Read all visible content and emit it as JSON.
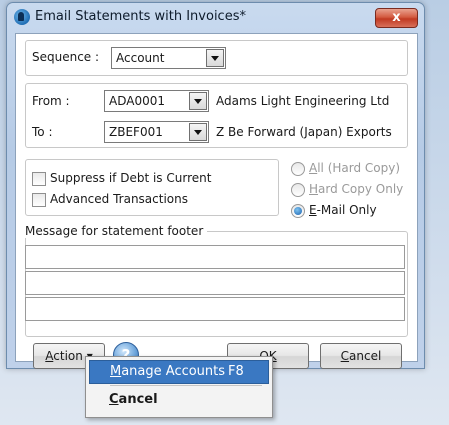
{
  "window": {
    "title": "Email Statements with Invoices*",
    "close_label": "x"
  },
  "sequence": {
    "label": "Sequence :",
    "value": "Account"
  },
  "range": {
    "from_label": "From :",
    "from_code": "ADA0001",
    "from_name": "Adams Light Engineering Ltd",
    "to_label": "To :",
    "to_code": "ZBEF001",
    "to_name": "Z Be Forward (Japan) Exports"
  },
  "options": {
    "suppress_label": "Suppress if Debt is Current",
    "suppress_checked": false,
    "advanced_label": "Advanced Transactions",
    "advanced_checked": false
  },
  "output": {
    "all_first": "A",
    "all_rest": "ll (Hard Copy)",
    "hard_first": "H",
    "hard_rest": "ard Copy Only",
    "email_first": "E",
    "email_rest": "-Mail Only",
    "selected": "email"
  },
  "message": {
    "label": "Message for statement footer",
    "lines": [
      "",
      "",
      ""
    ]
  },
  "buttons": {
    "action_first": "A",
    "action_rest": "ction",
    "ok_pre": "O",
    "ok_first": "K",
    "cancel_first": "C",
    "cancel_rest": "ancel"
  },
  "action_menu": {
    "manage_first": "M",
    "manage_rest": "anage Accounts",
    "manage_shortcut": "F8",
    "cancel_first": "C",
    "cancel_rest": "ancel"
  },
  "colors": {
    "menu_highlight": "#3a78c2",
    "close_button": "#c13a22"
  }
}
